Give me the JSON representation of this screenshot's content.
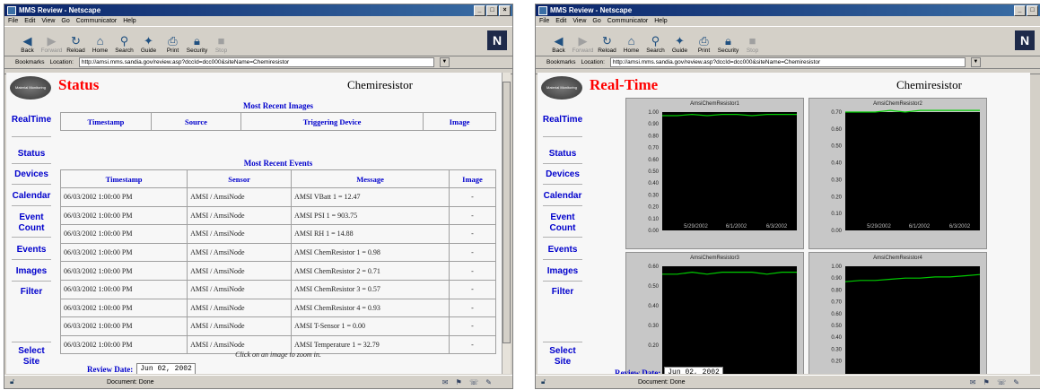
{
  "browser": {
    "title": "MMS Review - Netscape",
    "menu": [
      "File",
      "Edit",
      "View",
      "Go",
      "Communicator",
      "Help"
    ],
    "toolbar": [
      {
        "label": "Back",
        "icon": "back-arrow-icon"
      },
      {
        "label": "Forward",
        "icon": "forward-arrow-icon",
        "disabled": true
      },
      {
        "label": "Reload",
        "icon": "reload-icon"
      },
      {
        "label": "Home",
        "icon": "home-icon"
      },
      {
        "label": "Search",
        "icon": "search-icon"
      },
      {
        "label": "Guide",
        "icon": "guide-icon"
      },
      {
        "label": "Print",
        "icon": "print-icon"
      },
      {
        "label": "Security",
        "icon": "lock-icon"
      },
      {
        "label": "Stop",
        "icon": "stop-icon",
        "disabled": true
      }
    ],
    "bookmarks_label": "Bookmarks",
    "location_label": "Location:",
    "url": "http://amsi.mms.sandia.gov/review.asp?dccId=dcc000&siteName=Chemiresistor",
    "status_text": "Document: Done"
  },
  "sidebar": {
    "logo_text": "Material Monitoring",
    "items": [
      {
        "label": "RealTime"
      },
      {
        "label": "Status"
      },
      {
        "label": "Devices"
      },
      {
        "label": "Calendar"
      },
      {
        "label": "Event Count"
      },
      {
        "label": "Events"
      },
      {
        "label": "Images"
      },
      {
        "label": "Filter"
      },
      {
        "label": "Select Site"
      }
    ]
  },
  "site_name": "Chemiresistor",
  "review": {
    "label": "Review Date:",
    "value": "Jun 02, 2002"
  },
  "status_page": {
    "title": "Status",
    "images_section": {
      "title": "Most Recent Images",
      "columns": [
        "Timestamp",
        "Source",
        "Triggering Device",
        "Image"
      ]
    },
    "events_section": {
      "title": "Most Recent Events",
      "columns": [
        "Timestamp",
        "Sensor",
        "Message",
        "Image"
      ],
      "rows": [
        [
          "06/03/2002 1:00:00 PM",
          "AMSI / AmsiNode",
          "AMSI VBatt 1 = 12.47",
          "-"
        ],
        [
          "06/03/2002 1:00:00 PM",
          "AMSI / AmsiNode",
          "AMSI PSI 1 = 903.75",
          "-"
        ],
        [
          "06/03/2002 1:00:00 PM",
          "AMSI / AmsiNode",
          "AMSI RH 1 = 14.88",
          "-"
        ],
        [
          "06/03/2002 1:00:00 PM",
          "AMSI / AmsiNode",
          "AMSI ChemResistor 1 = 0.98",
          "-"
        ],
        [
          "06/03/2002 1:00:00 PM",
          "AMSI / AmsiNode",
          "AMSI ChemResistor 2 = 0.71",
          "-"
        ],
        [
          "06/03/2002 1:00:00 PM",
          "AMSI / AmsiNode",
          "AMSI ChemResistor 3 = 0.57",
          "-"
        ],
        [
          "06/03/2002 1:00:00 PM",
          "AMSI / AmsiNode",
          "AMSI ChemResistor 4 = 0.93",
          "-"
        ],
        [
          "06/03/2002 1:00:00 PM",
          "AMSI / AmsiNode",
          "AMSI T-Sensor 1 = 0.00",
          "-"
        ],
        [
          "06/03/2002 1:00:00 PM",
          "AMSI / AmsiNode",
          "AMSI Temperature 1 = 32.79",
          "-"
        ]
      ]
    },
    "click_note": "Click on an image to zoom in."
  },
  "realtime_page": {
    "title": "Real-Time"
  },
  "chart_data": [
    {
      "type": "line",
      "title": "AmsiChemResistor1",
      "ylim": [
        0.0,
        1.0
      ],
      "yticks": [
        "1.00",
        "0.90",
        "0.80",
        "0.70",
        "0.60",
        "0.50",
        "0.40",
        "0.30",
        "0.20",
        "0.10",
        "0.00"
      ],
      "xticks": [
        "5/29/2002",
        "6/1/2002",
        "6/3/2002"
      ],
      "series": [
        {
          "color": "#00cc00",
          "values": [
            0.97,
            0.97,
            0.98,
            0.97,
            0.98,
            0.98,
            0.97,
            0.98,
            0.98,
            0.98
          ]
        }
      ]
    },
    {
      "type": "line",
      "title": "AmsiChemResistor2",
      "ylim": [
        0.0,
        0.7
      ],
      "yticks": [
        "0.70",
        "0.60",
        "0.50",
        "0.40",
        "0.30",
        "0.20",
        "0.10",
        "0.00"
      ],
      "xticks": [
        "5/29/2002",
        "6/1/2002",
        "6/3/2002"
      ],
      "series": [
        {
          "color": "#00cc00",
          "values": [
            0.7,
            0.7,
            0.7,
            0.71,
            0.7,
            0.71,
            0.71,
            0.71,
            0.71,
            0.71
          ]
        }
      ]
    },
    {
      "type": "line",
      "title": "AmsiChemResistor3",
      "ylim": [
        0.0,
        0.6
      ],
      "yticks": [
        "0.60",
        "0.50",
        "0.40",
        "0.30",
        "0.20"
      ],
      "xticks": [],
      "series": [
        {
          "color": "#00cc00",
          "values": [
            0.56,
            0.56,
            0.57,
            0.56,
            0.57,
            0.57,
            0.57,
            0.56,
            0.57,
            0.57
          ]
        }
      ]
    },
    {
      "type": "line",
      "title": "AmsiChemResistor4",
      "ylim": [
        0.0,
        1.0
      ],
      "yticks": [
        "1.00",
        "0.90",
        "0.80",
        "0.70",
        "0.60",
        "0.50",
        "0.40",
        "0.30",
        "0.20"
      ],
      "xticks": [],
      "series": [
        {
          "color": "#00cc00",
          "values": [
            0.87,
            0.88,
            0.88,
            0.89,
            0.9,
            0.9,
            0.91,
            0.91,
            0.92,
            0.93
          ]
        }
      ]
    }
  ],
  "colors": {
    "title_red": "#ff0000",
    "link_blue": "#0000cc",
    "chart_background": "#000000",
    "series_green": "#00cc00"
  }
}
